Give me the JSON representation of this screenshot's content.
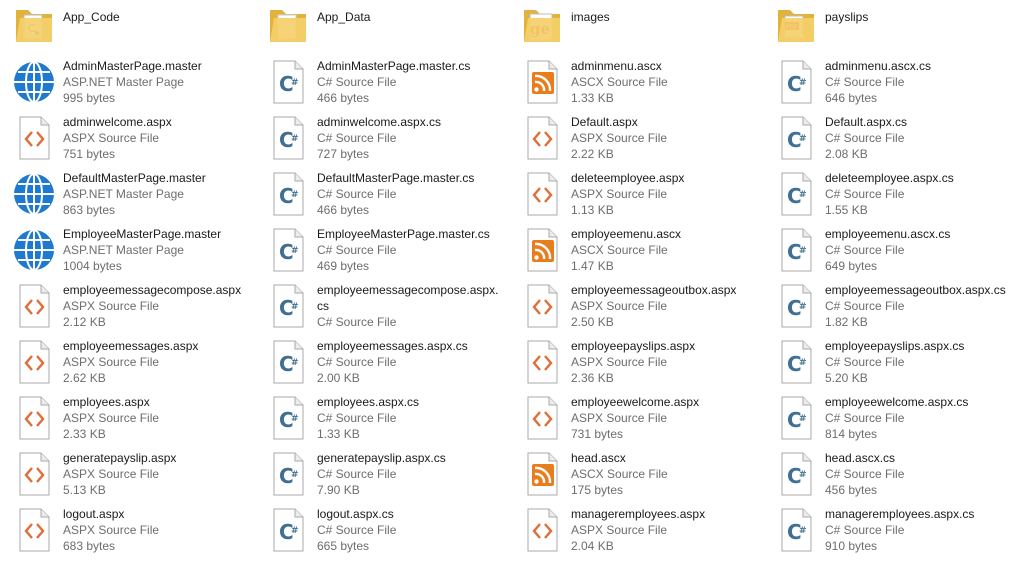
{
  "explorer": {
    "rows": [
      [
        {
          "name": "App_Code",
          "kind": "folder",
          "icon": "folder-code-icon"
        },
        {
          "name": "App_Data",
          "kind": "folder",
          "icon": "folder-icon"
        },
        {
          "name": "images",
          "kind": "folder",
          "icon": "folder-images-icon"
        },
        {
          "name": "payslips",
          "kind": "folder",
          "icon": "folder-pdf-icon"
        }
      ],
      [
        {
          "name": "AdminMasterPage.master",
          "kind": "master",
          "icon": "globe-icon",
          "type": "ASP.NET Master Page",
          "size": "995 bytes"
        },
        {
          "name": "AdminMasterPage.master.cs",
          "kind": "cs",
          "icon": "csharp-file-icon",
          "type": "C# Source File",
          "size": "466 bytes"
        },
        {
          "name": "adminmenu.ascx",
          "kind": "ascx",
          "icon": "rss-file-icon",
          "type": "ASCX Source File",
          "size": "1.33 KB"
        },
        {
          "name": "adminmenu.ascx.cs",
          "kind": "cs",
          "icon": "csharp-file-icon",
          "type": "C# Source File",
          "size": "646 bytes"
        }
      ],
      [
        {
          "name": "adminwelcome.aspx",
          "kind": "aspx",
          "icon": "code-file-icon",
          "type": "ASPX Source File",
          "size": "751 bytes"
        },
        {
          "name": "adminwelcome.aspx.cs",
          "kind": "cs",
          "icon": "csharp-file-icon",
          "type": "C# Source File",
          "size": "727 bytes"
        },
        {
          "name": "Default.aspx",
          "kind": "aspx",
          "icon": "code-file-icon",
          "type": "ASPX Source File",
          "size": "2.22 KB"
        },
        {
          "name": "Default.aspx.cs",
          "kind": "cs",
          "icon": "csharp-file-icon",
          "type": "C# Source File",
          "size": "2.08 KB"
        }
      ],
      [
        {
          "name": "DefaultMasterPage.master",
          "kind": "master",
          "icon": "globe-icon",
          "type": "ASP.NET Master Page",
          "size": "863 bytes"
        },
        {
          "name": "DefaultMasterPage.master.cs",
          "kind": "cs",
          "icon": "csharp-file-icon",
          "type": "C# Source File",
          "size": "466 bytes"
        },
        {
          "name": "deleteemployee.aspx",
          "kind": "aspx",
          "icon": "code-file-icon",
          "type": "ASPX Source File",
          "size": "1.13 KB"
        },
        {
          "name": "deleteemployee.aspx.cs",
          "kind": "cs",
          "icon": "csharp-file-icon",
          "type": "C# Source File",
          "size": "1.55 KB"
        }
      ],
      [
        {
          "name": "EmployeeMasterPage.master",
          "kind": "master",
          "icon": "globe-icon",
          "type": "ASP.NET Master Page",
          "size": "1004 bytes"
        },
        {
          "name": "EmployeeMasterPage.master.cs",
          "kind": "cs",
          "icon": "csharp-file-icon",
          "type": "C# Source File",
          "size": "469 bytes"
        },
        {
          "name": "employeemenu.ascx",
          "kind": "ascx",
          "icon": "rss-file-icon",
          "type": "ASCX Source File",
          "size": "1.47 KB"
        },
        {
          "name": "employeemenu.ascx.cs",
          "kind": "cs",
          "icon": "csharp-file-icon",
          "type": "C# Source File",
          "size": "649 bytes"
        }
      ],
      [
        {
          "name": "employeemessagecompose.aspx",
          "kind": "aspx",
          "icon": "code-file-icon",
          "type": "ASPX Source File",
          "size": "2.12 KB"
        },
        {
          "name": "employeemessagecompose.aspx.cs",
          "kind": "cs",
          "icon": "csharp-file-icon",
          "type": "C# Source File",
          "size": ""
        },
        {
          "name": "employeemessageoutbox.aspx",
          "kind": "aspx",
          "icon": "code-file-icon",
          "type": "ASPX Source File",
          "size": "2.50 KB"
        },
        {
          "name": "employeemessageoutbox.aspx.cs",
          "kind": "cs",
          "icon": "csharp-file-icon",
          "type": "C# Source File",
          "size": "1.82 KB"
        }
      ],
      [
        {
          "name": "employeemessages.aspx",
          "kind": "aspx",
          "icon": "code-file-icon",
          "type": "ASPX Source File",
          "size": "2.62 KB"
        },
        {
          "name": "employeemessages.aspx.cs",
          "kind": "cs",
          "icon": "csharp-file-icon",
          "type": "C# Source File",
          "size": "2.00 KB"
        },
        {
          "name": "employeepayslips.aspx",
          "kind": "aspx",
          "icon": "code-file-icon",
          "type": "ASPX Source File",
          "size": "2.36 KB"
        },
        {
          "name": "employeepayslips.aspx.cs",
          "kind": "cs",
          "icon": "csharp-file-icon",
          "type": "C# Source File",
          "size": "5.20 KB"
        }
      ],
      [
        {
          "name": "employees.aspx",
          "kind": "aspx",
          "icon": "code-file-icon",
          "type": "ASPX Source File",
          "size": "2.33 KB"
        },
        {
          "name": "employees.aspx.cs",
          "kind": "cs",
          "icon": "csharp-file-icon",
          "type": "C# Source File",
          "size": "1.33 KB"
        },
        {
          "name": "employeewelcome.aspx",
          "kind": "aspx",
          "icon": "code-file-icon",
          "type": "ASPX Source File",
          "size": "731 bytes"
        },
        {
          "name": "employeewelcome.aspx.cs",
          "kind": "cs",
          "icon": "csharp-file-icon",
          "type": "C# Source File",
          "size": "814 bytes"
        }
      ],
      [
        {
          "name": "generatepayslip.aspx",
          "kind": "aspx",
          "icon": "code-file-icon",
          "type": "ASPX Source File",
          "size": "5.13 KB"
        },
        {
          "name": "generatepayslip.aspx.cs",
          "kind": "cs",
          "icon": "csharp-file-icon",
          "type": "C# Source File",
          "size": "7.90 KB"
        },
        {
          "name": "head.ascx",
          "kind": "ascx",
          "icon": "rss-file-icon",
          "type": "ASCX Source File",
          "size": "175 bytes"
        },
        {
          "name": "head.ascx.cs",
          "kind": "cs",
          "icon": "csharp-file-icon",
          "type": "C# Source File",
          "size": "456 bytes"
        }
      ],
      [
        {
          "name": "logout.aspx",
          "kind": "aspx",
          "icon": "code-file-icon",
          "type": "ASPX Source File",
          "size": "683 bytes"
        },
        {
          "name": "logout.aspx.cs",
          "kind": "cs",
          "icon": "csharp-file-icon",
          "type": "C# Source File",
          "size": "665 bytes"
        },
        {
          "name": "manageremployees.aspx",
          "kind": "aspx",
          "icon": "code-file-icon",
          "type": "ASPX Source File",
          "size": "2.04 KB"
        },
        {
          "name": "manageremployees.aspx.cs",
          "kind": "cs",
          "icon": "csharp-file-icon",
          "type": "C# Source File",
          "size": "910 bytes"
        }
      ]
    ]
  },
  "colors": {
    "folder": "#f4cf6a",
    "folder_dark": "#e2b33c",
    "globe": "#1e7ad1",
    "csharp": "#3f6f92",
    "aspx": "#e06c3a",
    "rss": "#e87d1e",
    "text": "#1a1a1a",
    "meta": "#6d6d6d"
  }
}
